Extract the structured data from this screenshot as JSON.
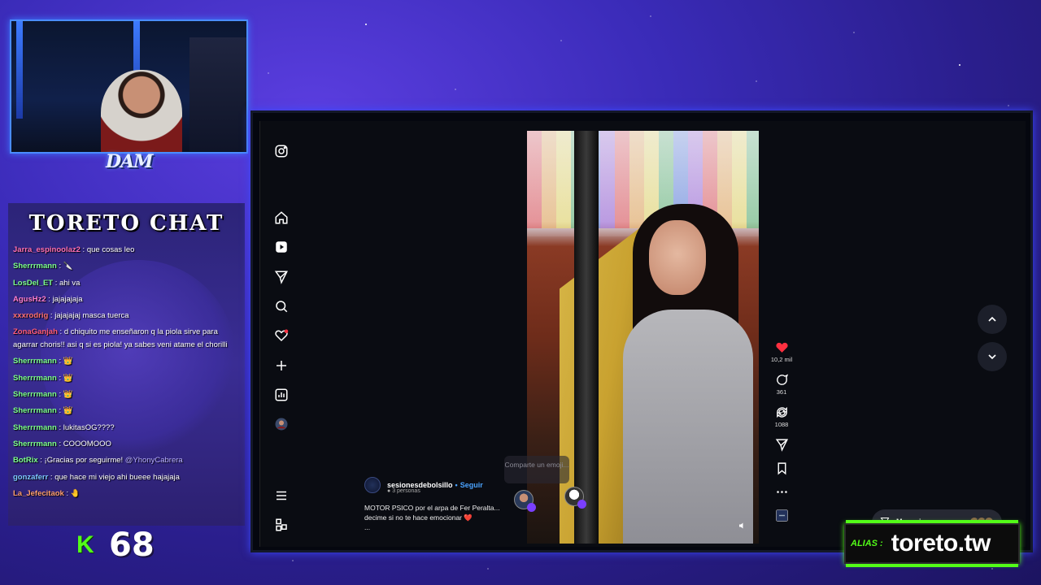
{
  "overlay": {
    "cam_logo": "DAM",
    "chat_title": "TORETO CHAT",
    "kick_icon": "K",
    "viewer_count": "68",
    "alias_label": "ALIAS :",
    "alias_value": "toreto.tw",
    "colors": {
      "kick_green": "#53fc18",
      "background": "#3a2bb8"
    }
  },
  "chat": {
    "lines": [
      {
        "user": "Jarra_espinoolaz2",
        "user_color": "#ff6fb1",
        "text": ": que cosas leo"
      },
      {
        "user": "Sherrrmann",
        "user_color": "#7dff8c",
        "text": ": 🔪"
      },
      {
        "user": "LosDel_ET",
        "user_color": "#7dff8c",
        "text": ": ahi va"
      },
      {
        "user": "AgusHz2",
        "user_color": "#ff7fd1",
        "text": ": jajajajaja"
      },
      {
        "user": "xxxrodrig",
        "user_color": "#ff6f6f",
        "text": ": jajajajaj masca tuerca"
      },
      {
        "user": "ZonaGanjah",
        "user_color": "#ff5c7a",
        "text": ": d chiquito me enseñaron q la piola sirve para agarrar choris!! asi q si es piola! ya sabes veni atame el chorilli"
      },
      {
        "user": "Sherrrmann",
        "user_color": "#7dff8c",
        "text": ": 👑"
      },
      {
        "user": "Sherrrmann",
        "user_color": "#7dff8c",
        "text": ": 👑"
      },
      {
        "user": "Sherrrmann",
        "user_color": "#7dff8c",
        "text": ": 👑"
      },
      {
        "user": "Sherrrmann",
        "user_color": "#7dff8c",
        "text": ": 👑"
      },
      {
        "user": "Sherrrmann",
        "user_color": "#7dff8c",
        "text": ": lukitasOG????"
      },
      {
        "user": "Sherrrmann",
        "user_color": "#7dff8c",
        "text": ": COOOMOOO"
      },
      {
        "user": "BotRix",
        "user_color": "#7dff8c",
        "text": ": ¡Gracias por seguirme! ",
        "mention": "@YhonyCabrera"
      },
      {
        "user": "gonzaferr",
        "user_color": "#7dc8ff",
        "text": ": que hace mi viejo ahi bueee hajajaja"
      },
      {
        "user": "La_Jefecitaok",
        "user_color": "#ff9f6f",
        "text": ": 🤚"
      }
    ]
  },
  "instagram": {
    "sidebar_icons": [
      "instagram-icon",
      "home-icon",
      "reels-icon",
      "send-icon",
      "search-icon",
      "notifications-icon",
      "create-icon",
      "dashboard-icon",
      "profile-icon",
      "menu-icon",
      "more-apps-icon"
    ],
    "post": {
      "username": "sesionesdebolsillo",
      "separator": "•",
      "follow_label": "Seguir",
      "followers": "3 personas",
      "caption_line1": "MOTOR PSICO por el arpa de Fer Peralta...",
      "caption_line2": "decime si no te hace emocionar ❤️",
      "caption_more": "..."
    },
    "share_hint": "Comparte un emoji...",
    "actions": {
      "likes": "10,2 mil",
      "comments": "361",
      "reposts": "1088"
    },
    "messages_label": "Mensajes",
    "colors": {
      "like_red": "#ff3040",
      "link_blue": "#4aa3ff"
    }
  }
}
